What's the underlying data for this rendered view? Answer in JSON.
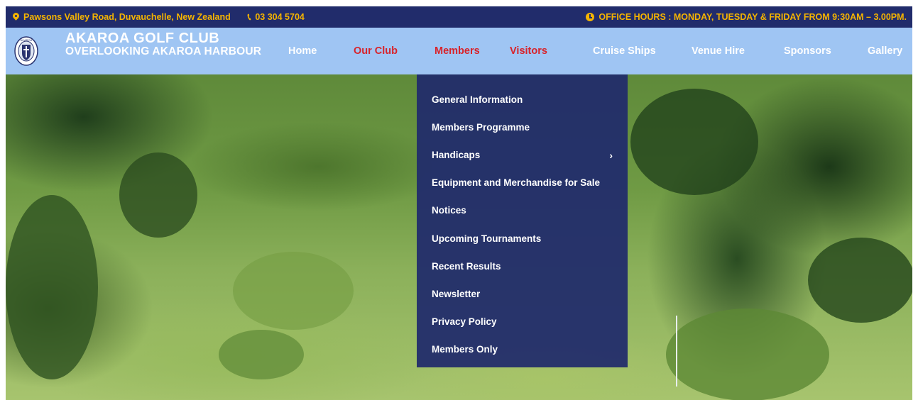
{
  "topbar": {
    "address": "Pawsons Valley Road, Duvauchelle, New Zealand",
    "phone": "03 304 5704",
    "hours": "OFFICE HOURS : MONDAY, TUESDAY & FRIDAY FROM 9:30AM – 3.00PM."
  },
  "brand": {
    "name": "AKAROA GOLF CLUB",
    "tagline": "OVERLOOKING AKAROA HARBOUR",
    "logo_text": "AKAROA GOLF CLUB"
  },
  "nav": {
    "items": [
      {
        "label": "Home"
      },
      {
        "label": "Our Club"
      },
      {
        "label": "Members"
      },
      {
        "label": "Visitors"
      },
      {
        "label": "Cruise Ships"
      },
      {
        "label": "Venue Hire"
      },
      {
        "label": "Sponsors"
      },
      {
        "label": "Gallery"
      }
    ]
  },
  "dropdown": {
    "items": [
      {
        "label": "General Information"
      },
      {
        "label": "Members Programme"
      },
      {
        "label": "Handicaps",
        "has_submenu": true
      },
      {
        "label": "Equipment and Merchandise for Sale"
      },
      {
        "label": "Notices"
      },
      {
        "label": "Upcoming Tournaments"
      },
      {
        "label": "Recent Results"
      },
      {
        "label": "Newsletter"
      },
      {
        "label": "Privacy Policy"
      },
      {
        "label": "Members Only"
      }
    ],
    "submenu_icon": "chevron-right-icon"
  },
  "colors": {
    "topbar_bg": "#212c6b",
    "topbar_text": "#f5b400",
    "navbar_bg": "#9fc5f3",
    "nav_active": "#d8232a",
    "dropdown_bg": "#212c6b"
  }
}
